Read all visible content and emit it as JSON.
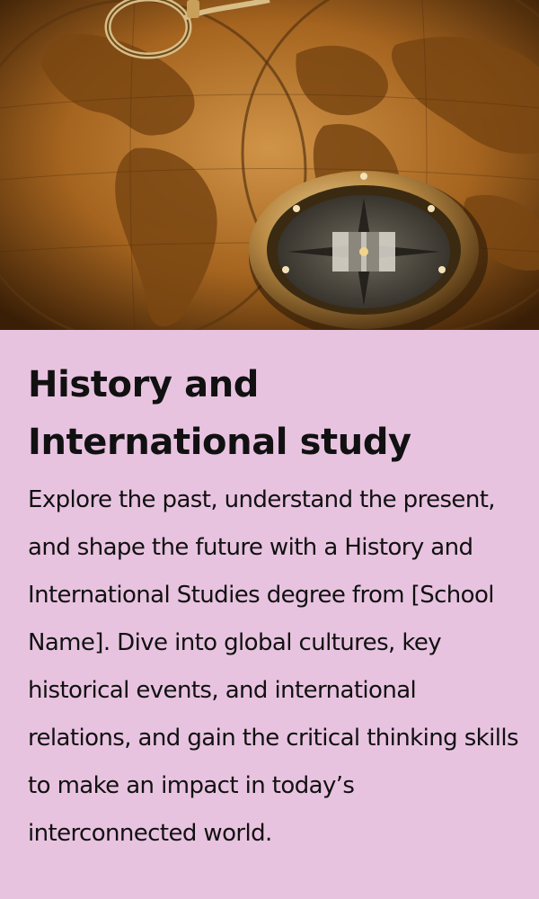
{
  "hero": {
    "image": "antique-world-map-with-compass",
    "colors": {
      "parchment": "#c88a3a",
      "land": "#8a5418",
      "dark": "#2e1805",
      "brass": "#c9a05a"
    }
  },
  "card": {
    "title": "History and International study",
    "body": "Explore the past, understand the present, and shape the future with a History and International Studies degree from [School Name]. Dive into global cultures, key historical events, and international relations, and gain the critical thinking skills to make an impact in today’s interconnected world.",
    "background": "#e8c3e0"
  }
}
